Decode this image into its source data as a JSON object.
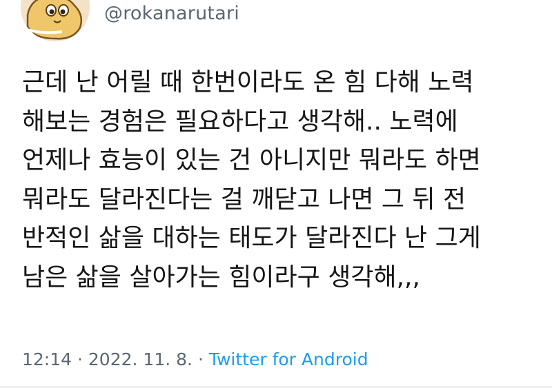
{
  "user": {
    "handle": "@rokanarutari"
  },
  "tweet": {
    "lines": [
      "근데 난 어릴 때 한번이라도 온 힘 다해 노력",
      "해보는 경험은 필요하다고 생각해.. 노력에",
      "언제나 효능이 있는 건 아니지만 뭐라도 하면",
      "뭐라도 달라진다는 걸 깨닫고 나면 그 뒤 전",
      "반적인 삶을 대하는 태도가 달라진다 난 그게",
      "남은 삶을 살아가는 힘이라구 생각해,,,"
    ]
  },
  "meta": {
    "time": "12:14",
    "separator": "·",
    "date": "2022. 11. 8.",
    "source": "Twitter for Android"
  },
  "colors": {
    "text": "#161616",
    "secondary": "#5b6670",
    "link": "#1d9bf0",
    "avatar_bg": "#f4e2c7"
  }
}
